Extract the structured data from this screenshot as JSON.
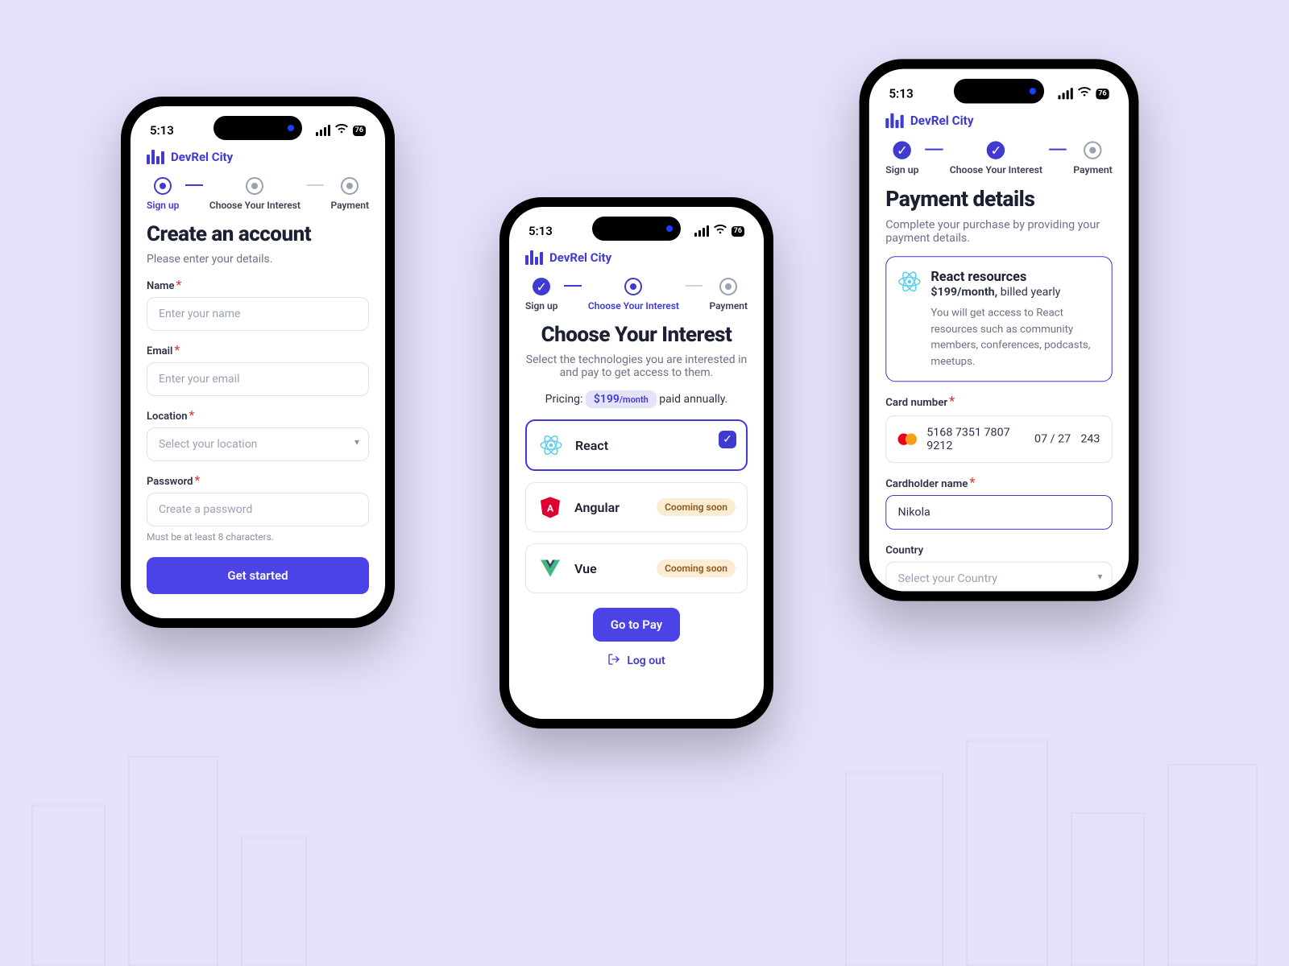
{
  "status": {
    "time": "5:13",
    "battery": "76"
  },
  "brand": "DevRel City",
  "stepper": {
    "s1": "Sign up",
    "s2": "Choose Your Interest",
    "s3": "Payment"
  },
  "screen1": {
    "title": "Create an account",
    "subtitle": "Please enter your details.",
    "name_label": "Name",
    "name_placeholder": "Enter your name",
    "email_label": "Email",
    "email_placeholder": "Enter your email",
    "location_label": "Location",
    "location_placeholder": "Select your location",
    "password_label": "Password",
    "password_placeholder": "Create a password",
    "password_hint": "Must be at least 8 characters.",
    "cta": "Get started"
  },
  "screen2": {
    "title": "Choose Your Interest",
    "subtitle": "Select the technologies you are interested in and pay to get access to them.",
    "pricing_label": "Pricing:",
    "price": "$199",
    "price_unit": "/month",
    "price_suffix": "paid annually.",
    "tech": {
      "react": "React",
      "angular": "Angular",
      "vue": "Vue"
    },
    "soon": "Cooming soon",
    "cta": "Go to Pay",
    "logout": "Log out"
  },
  "screen3": {
    "title": "Payment details",
    "subtitle": "Complete your purchase by providing your payment details.",
    "plan_title": "React resources",
    "plan_price": "$199/month,",
    "plan_billed": " billed yearly",
    "plan_desc": "You will get access to React resources such as community members, conferences, podcasts, meetups.",
    "card_label": "Card number",
    "card_number": "5168 7351 7807 9212",
    "card_exp": "07 / 27",
    "card_cvc": "243",
    "holder_label": "Cardholder name",
    "holder_value": "Nikola",
    "country_label": "Country",
    "country_placeholder": "Select your Country"
  }
}
